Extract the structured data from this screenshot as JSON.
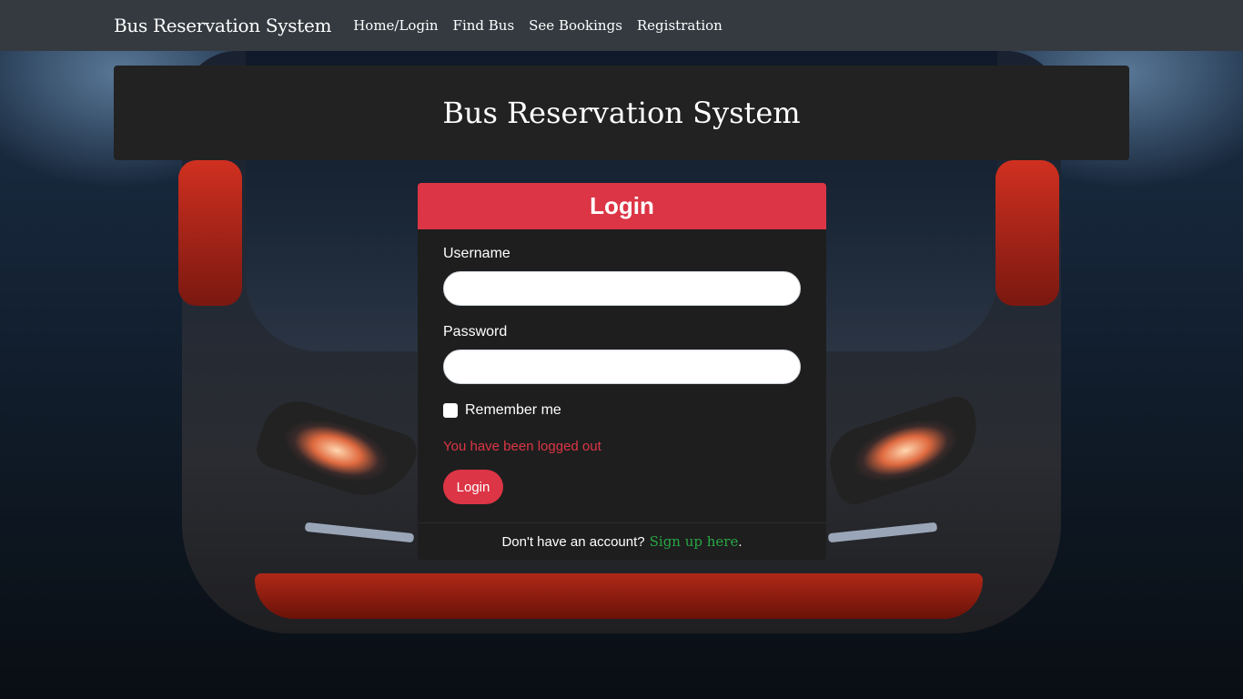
{
  "navbar": {
    "brand": "Bus Reservation System",
    "links": [
      "Home/Login",
      "Find Bus",
      "See Bookings",
      "Registration"
    ]
  },
  "jumbotron": {
    "title": "Bus Reservation System"
  },
  "login_card": {
    "title": "Login",
    "username_label": "Username",
    "username_value": "",
    "password_label": "Password",
    "password_value": "",
    "remember_label": "Remember me",
    "remember_checked": false,
    "message": "You have been logged out",
    "submit_label": "Login",
    "footer_text": "Don't have an account?",
    "signup_link": "Sign up here",
    "footer_period": "."
  },
  "colors": {
    "navbar_bg": "#343a40",
    "accent_red": "#dc3545",
    "link_green": "#28a745",
    "card_bg": "#1e1e1e"
  }
}
